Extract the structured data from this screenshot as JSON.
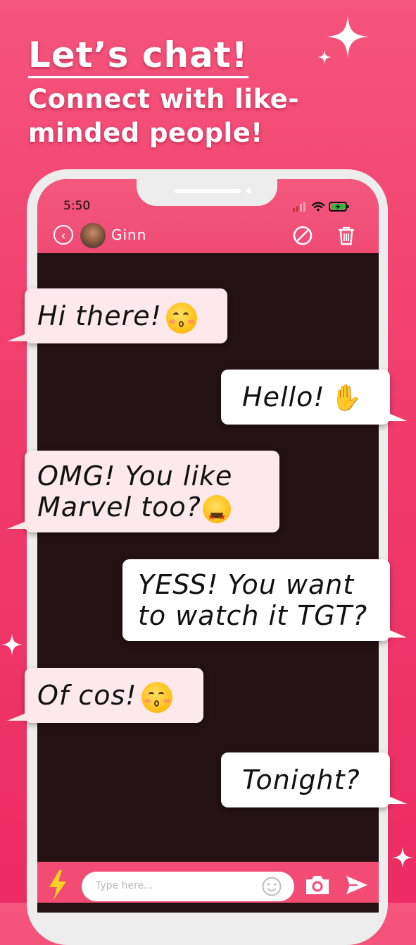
{
  "promo": {
    "title": "Let’s chat!",
    "subtitle": "Connect with like-minded people!"
  },
  "phone": {
    "status_time": "5:50",
    "contact_name": "Ginn",
    "input_placeholder": "Type here..."
  },
  "messages": [
    {
      "side": "left",
      "text": "Hi there!"
    },
    {
      "side": "right",
      "text": "Hello!"
    },
    {
      "side": "left",
      "line1": "OMG! You like",
      "line2": "Marvel too?"
    },
    {
      "side": "right",
      "line1": "YESS! You want",
      "line2": "to watch it TGT?"
    },
    {
      "side": "left",
      "text": "Of cos!"
    },
    {
      "side": "right",
      "text": "Tonight?"
    }
  ],
  "colors": {
    "background": "#f03c6c",
    "chat_bg": "#241114",
    "left_bubble": "#fde9eb",
    "right_bubble": "#ffffff"
  },
  "icons": [
    "back-icon",
    "block-icon",
    "trash-icon",
    "lightning-icon",
    "emoji-icon",
    "camera-icon",
    "send-icon",
    "wifi-icon",
    "signal-icon",
    "battery-icon"
  ]
}
